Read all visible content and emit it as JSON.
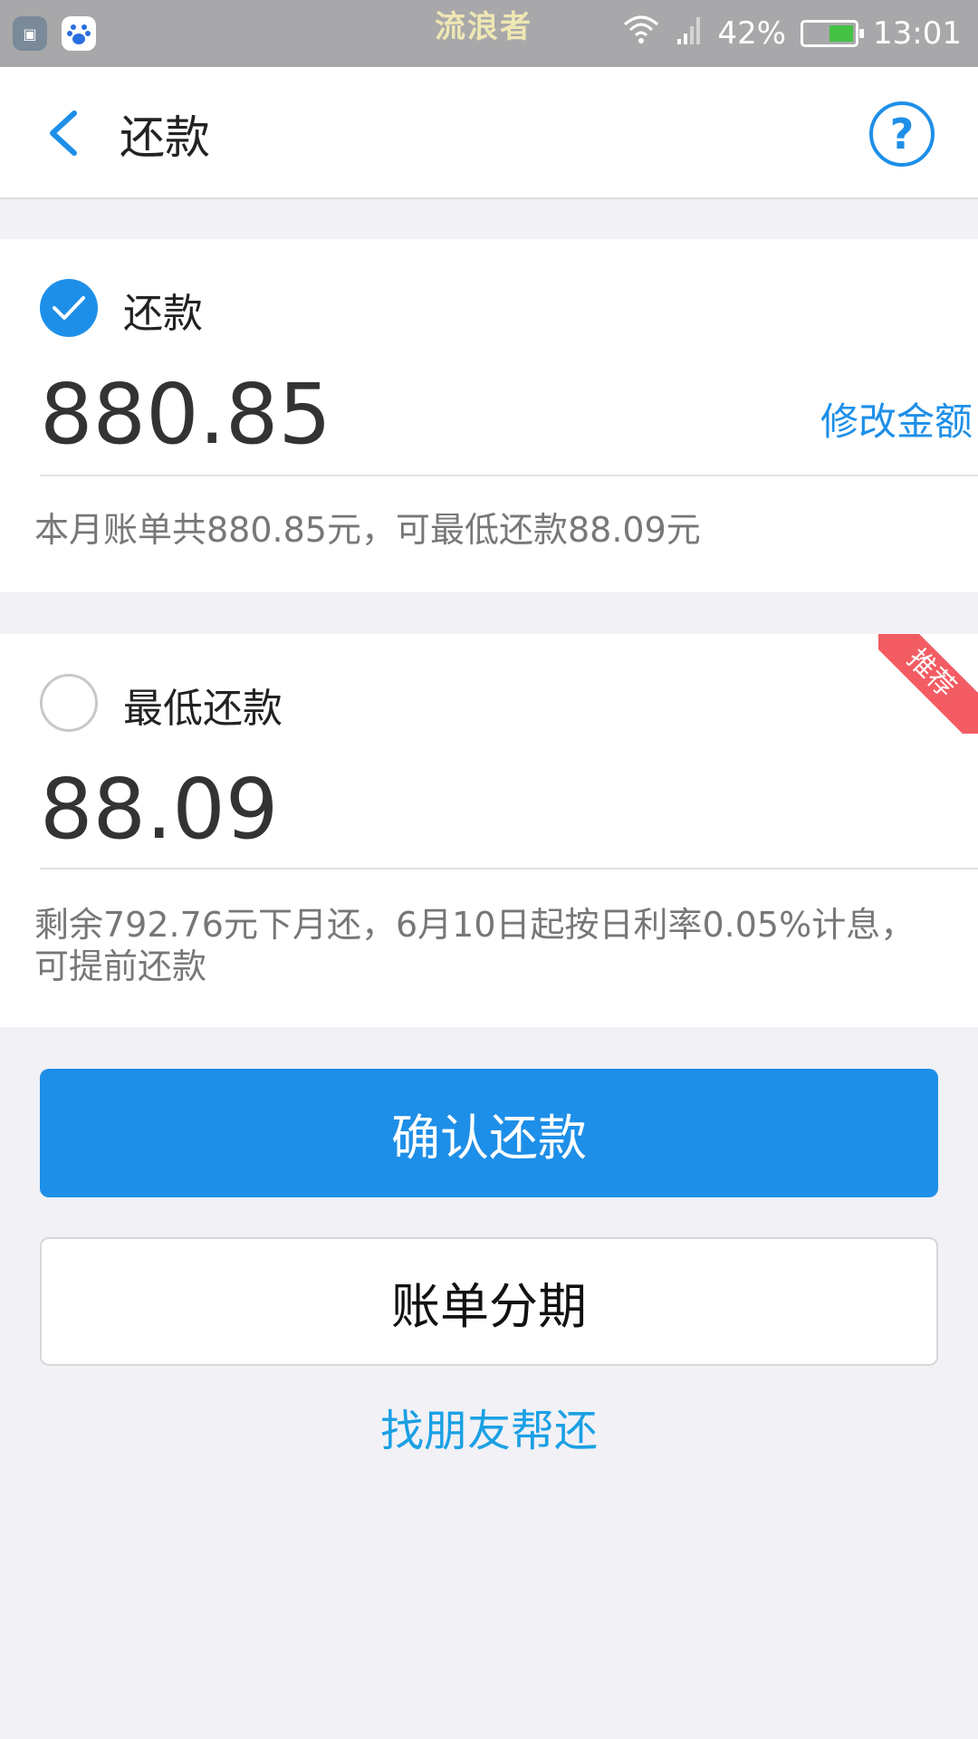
{
  "status_bar": {
    "app_icon_text": "▣",
    "center_text": "流浪者",
    "battery_percent": "42%",
    "battery_level": 0.42,
    "time": "13:01"
  },
  "header": {
    "title": "还款",
    "help_symbol": "?"
  },
  "option_full": {
    "label": "还款",
    "amount": "880.85",
    "edit_label": "修改金额",
    "note": "本月账单共880.85元，可最低还款88.09元",
    "selected": true
  },
  "option_min": {
    "label": "最低还款",
    "amount": "88.09",
    "badge": "推荐",
    "note": "剩余792.76元下月还，6月10日起按日利率0.05%计息，可提前还款",
    "selected": false
  },
  "actions": {
    "confirm": "确认还款",
    "installment": "账单分期",
    "friend_help": "找朋友帮还"
  },
  "colors": {
    "accent": "#1e8fe8",
    "badge": "#f25c62",
    "background": "#f1f1f6"
  }
}
